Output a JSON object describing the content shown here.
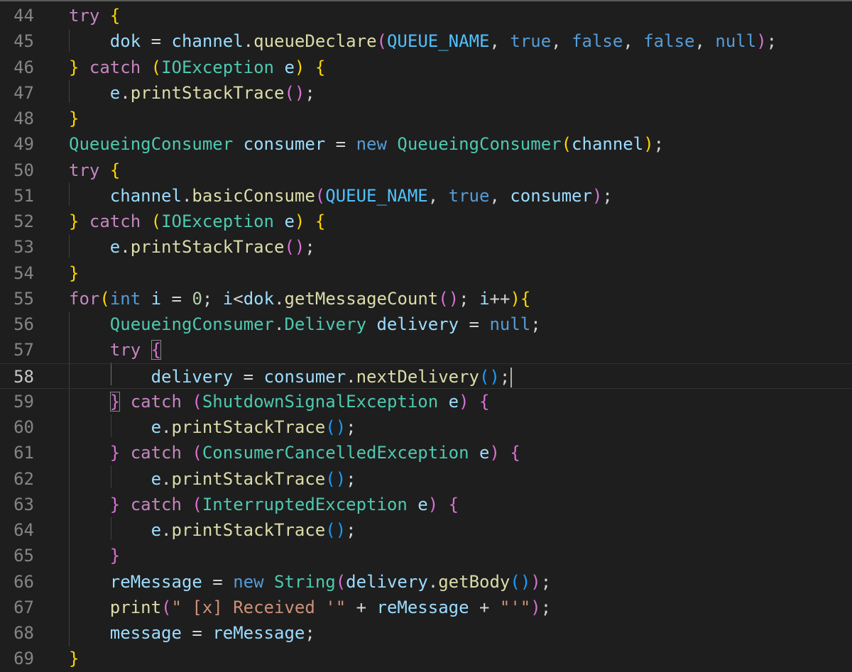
{
  "editor": {
    "language": "java",
    "current_line": 58,
    "colors": {
      "background": "#1e1e1e",
      "keyword": "#569cd6",
      "control": "#c586c0",
      "type": "#4ec9b0",
      "function": "#dcdcaa",
      "variable": "#9cdcfe",
      "string": "#ce9178",
      "bracket_level_1": "#ffd700",
      "bracket_level_2": "#da70d6",
      "bracket_level_3": "#179fff"
    },
    "lines": [
      {
        "number": "44",
        "text": "try {"
      },
      {
        "number": "45",
        "text": "    dok = channel.queueDeclare(QUEUE_NAME, true, false, false, null);"
      },
      {
        "number": "46",
        "text": "} catch (IOException e) {"
      },
      {
        "number": "47",
        "text": "    e.printStackTrace();"
      },
      {
        "number": "48",
        "text": "}"
      },
      {
        "number": "49",
        "text": "QueueingConsumer consumer = new QueueingConsumer(channel);"
      },
      {
        "number": "50",
        "text": "try {"
      },
      {
        "number": "51",
        "text": "    channel.basicConsume(QUEUE_NAME, true, consumer);"
      },
      {
        "number": "52",
        "text": "} catch (IOException e) {"
      },
      {
        "number": "53",
        "text": "    e.printStackTrace();"
      },
      {
        "number": "54",
        "text": "}"
      },
      {
        "number": "55",
        "text": "for(int i = 0; i<dok.getMessageCount(); i++){"
      },
      {
        "number": "56",
        "text": "    QueueingConsumer.Delivery delivery = null;"
      },
      {
        "number": "57",
        "text": "    try {"
      },
      {
        "number": "58",
        "text": "        delivery = consumer.nextDelivery();"
      },
      {
        "number": "59",
        "text": "    } catch (ShutdownSignalException e) {"
      },
      {
        "number": "60",
        "text": "        e.printStackTrace();"
      },
      {
        "number": "61",
        "text": "    } catch (ConsumerCancelledException e) {"
      },
      {
        "number": "62",
        "text": "        e.printStackTrace();"
      },
      {
        "number": "63",
        "text": "    } catch (InterruptedException e) {"
      },
      {
        "number": "64",
        "text": "        e.printStackTrace();"
      },
      {
        "number": "65",
        "text": "    }"
      },
      {
        "number": "66",
        "text": "    reMessage = new String(delivery.getBody());"
      },
      {
        "number": "67",
        "text": "    print(\" [x] Received '\" + reMessage + \"'\");"
      },
      {
        "number": "68",
        "text": "    message = reMessage;"
      },
      {
        "number": "69",
        "text": "}"
      }
    ]
  }
}
